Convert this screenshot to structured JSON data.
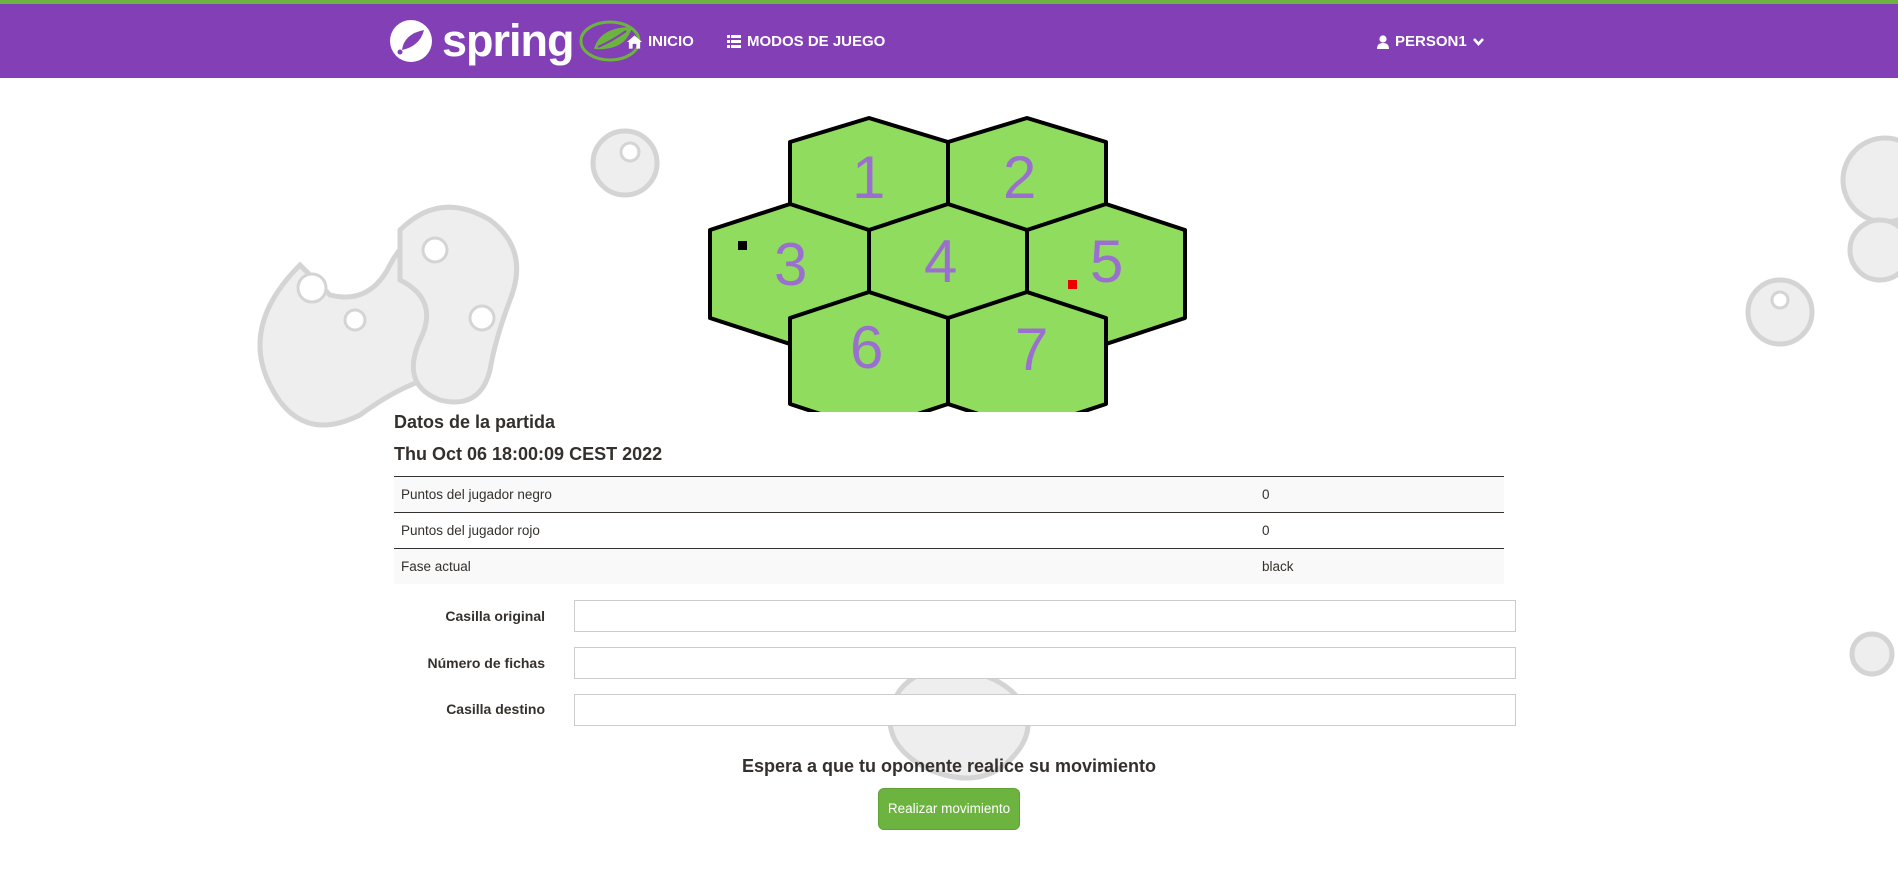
{
  "navbar": {
    "brand": "spring",
    "links": [
      {
        "label": "INICIO",
        "icon": "home-icon"
      },
      {
        "label": "MODOS DE JUEGO",
        "icon": "list-icon"
      }
    ],
    "user": {
      "label": "PERSON1",
      "icon": "user-icon"
    }
  },
  "board": {
    "cells": [
      "1",
      "2",
      "3",
      "4",
      "5",
      "6",
      "7"
    ],
    "hex_color": "#8fdc5e",
    "label_color": "#9b6fcf",
    "pieces": [
      {
        "cell": "3",
        "color": "black"
      },
      {
        "cell": "5",
        "color": "red"
      }
    ]
  },
  "game": {
    "title": "Datos de la partida",
    "date": "Thu Oct 06 18:00:09 CEST 2022",
    "rows": [
      {
        "label": "Puntos del jugador negro",
        "value": "0"
      },
      {
        "label": "Puntos del jugador rojo",
        "value": "0"
      },
      {
        "label": "Fase actual",
        "value": "black"
      }
    ]
  },
  "form": {
    "fields": [
      {
        "label": "Casilla original",
        "value": ""
      },
      {
        "label": "Número de fichas",
        "value": ""
      },
      {
        "label": "Casilla destino",
        "value": ""
      }
    ],
    "wait_message": "Espera a que tu oponente realice su movimiento",
    "submit_label": "Realizar movimiento"
  },
  "colors": {
    "navbar": "#833fb6",
    "accent": "#6db33f",
    "text": "#34302d"
  }
}
